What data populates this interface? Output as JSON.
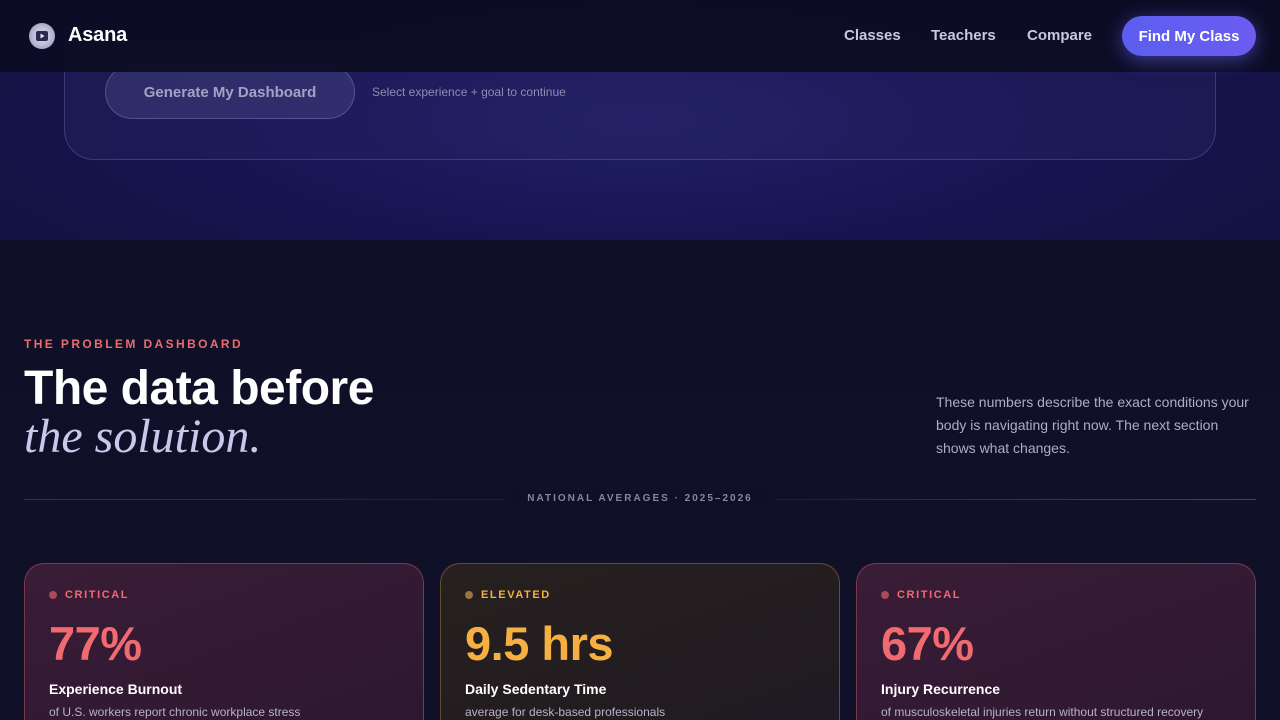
{
  "header": {
    "brand": "Asana",
    "nav": [
      "Classes",
      "Teachers",
      "Compare"
    ],
    "cta": "Find My Class"
  },
  "generator": {
    "button": "Generate My Dashboard",
    "hint": "Select experience + goal to continue"
  },
  "section": {
    "eyebrow": "THE PROBLEM DASHBOARD",
    "title_line1": "The data before",
    "title_line2": "the solution.",
    "lede": "These numbers describe the exact conditions your body is navigating right now. The next section shows what changes.",
    "divider_label": "NATIONAL AVERAGES · 2025–2026"
  },
  "cards": [
    {
      "status": "CRITICAL",
      "value": "77%",
      "label": "Experience Burnout",
      "desc": "of U.S. workers report chronic workplace stress",
      "accent": "#f06a6f",
      "dot": "#a84a5c"
    },
    {
      "status": "ELEVATED",
      "value": "9.5 hrs",
      "label": "Daily Sedentary Time",
      "desc": "average for desk-based professionals",
      "accent": "#f5b041",
      "dot": "#9a7340"
    },
    {
      "status": "CRITICAL",
      "value": "67%",
      "label": "Injury Recurrence",
      "desc": "of musculoskeletal injuries return without structured recovery",
      "accent": "#f06a6f",
      "dot": "#a84a5c"
    }
  ]
}
